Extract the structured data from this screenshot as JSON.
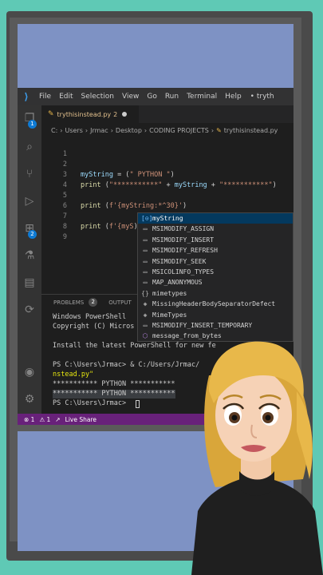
{
  "menubar": {
    "items": [
      "File",
      "Edit",
      "Selection",
      "View",
      "Go",
      "Run",
      "Terminal",
      "Help"
    ],
    "title": "• tryth"
  },
  "activity_badges": {
    "explorer": "1",
    "extensions": "2"
  },
  "tab": {
    "filename": "trythisinstead.py",
    "problems": "2"
  },
  "breadcrumb": [
    "C:",
    "Users",
    "Jrmac",
    "Desktop",
    "CODING PROJECTS",
    "trythisinstead.py"
  ],
  "editor": {
    "line_numbers": [
      "1",
      "2",
      "3",
      "4",
      "5",
      "6",
      "7",
      "8",
      "9"
    ],
    "line2": {
      "var": "myString",
      "op": " = (",
      "str": "\" PYTHON \"",
      "close": ")"
    },
    "line3": {
      "fn": "print",
      "open": " (",
      "str1": "\"***********\"",
      "op": " + ",
      "var": "myString",
      "op2": " + ",
      "str2": "\"***********\"",
      "close": ")"
    },
    "line5": {
      "fn": "print",
      "open": " (",
      "str": "f'{myString:*^30}'",
      "close": ")"
    },
    "line7": {
      "fn": "print",
      "open": " (",
      "str": "f'{myS",
      "close": ")"
    }
  },
  "suggestions": [
    {
      "icon": "variable-icon",
      "glyph": "[⊙]",
      "label": "myString"
    },
    {
      "icon": "constant-icon",
      "glyph": "▭",
      "label": "MSIMODIFY_ASSIGN"
    },
    {
      "icon": "constant-icon",
      "glyph": "▭",
      "label": "MSIMODIFY_INSERT"
    },
    {
      "icon": "constant-icon",
      "glyph": "▭",
      "label": "MSIMODIFY_REFRESH"
    },
    {
      "icon": "constant-icon",
      "glyph": "▭",
      "label": "MSIMODIFY_SEEK"
    },
    {
      "icon": "constant-icon",
      "glyph": "▭",
      "label": "MSICOLINFO_TYPES"
    },
    {
      "icon": "constant-icon",
      "glyph": "▭",
      "label": "MAP_ANONYMOUS"
    },
    {
      "icon": "module-icon",
      "glyph": "{}",
      "label": "mimetypes"
    },
    {
      "icon": "class-icon",
      "glyph": "◈",
      "label": "MissingHeaderBodySeparatorDefect"
    },
    {
      "icon": "class-icon",
      "glyph": "◈",
      "label": "MimeTypes"
    },
    {
      "icon": "constant-icon",
      "glyph": "▭",
      "label": "MSIMODIFY_INSERT_TEMPORARY"
    },
    {
      "icon": "method-icon",
      "glyph": "⬡",
      "label": "message_from_bytes"
    }
  ],
  "panel": {
    "problems_label": "PROBLEMS",
    "problems_count": "2",
    "output_label": "OUTPUT"
  },
  "terminal": {
    "lines": [
      "Windows PowerShell",
      "Copyright (C) Micros",
      "",
      "Install the latest PowerShell for new fe",
      "",
      "PS C:\\Users\\Jrmac> & C:/Users/Jrmac/",
      "nstead.py\"",
      "*********** PYTHON ***********",
      "*********** PYTHON ***********",
      "PS C:\\Users\\Jrmac> "
    ]
  },
  "statusbar": {
    "errors": "⊗ 1",
    "warnings": "⚠ 1",
    "liveshare": "Live Share"
  },
  "colors": {
    "statusbar": "#68217a",
    "background": "#5fc9b5",
    "monitor_screen": "#7e92c4"
  }
}
